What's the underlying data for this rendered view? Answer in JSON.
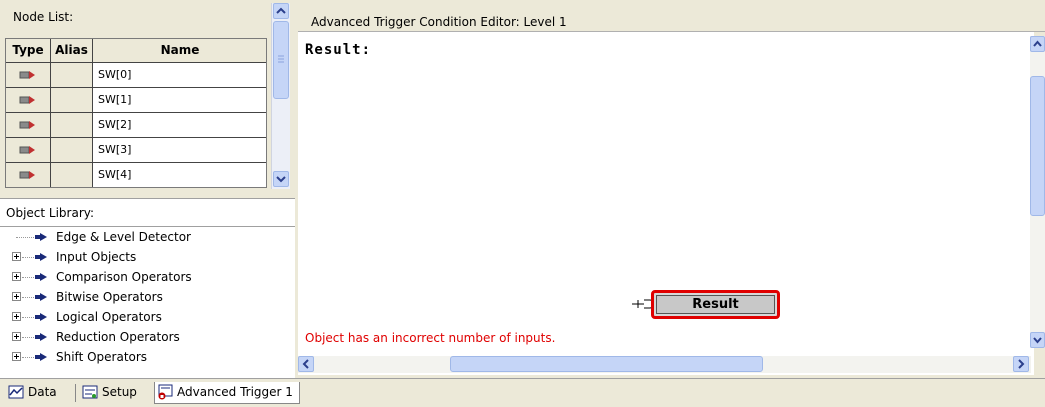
{
  "node_list": {
    "title": "Node List:",
    "columns": [
      "Type",
      "Alias",
      "Name"
    ],
    "rows": [
      {
        "name": "SW[0]"
      },
      {
        "name": "SW[1]"
      },
      {
        "name": "SW[2]"
      },
      {
        "name": "SW[3]"
      },
      {
        "name": "SW[4]"
      }
    ]
  },
  "object_library": {
    "title": "Object Library:",
    "items": [
      {
        "label": "Edge & Level Detector",
        "expandable": false
      },
      {
        "label": "Input Objects",
        "expandable": true
      },
      {
        "label": "Comparison Operators",
        "expandable": true
      },
      {
        "label": "Bitwise Operators",
        "expandable": true
      },
      {
        "label": "Logical Operators",
        "expandable": true
      },
      {
        "label": "Reduction Operators",
        "expandable": true
      },
      {
        "label": "Shift Operators",
        "expandable": true
      }
    ]
  },
  "editor": {
    "title": "Advanced Trigger Condition Editor: Level 1",
    "result_text": "Result:",
    "result_node_label": "Result",
    "error_message": "Object has an incorrect number of inputs.",
    "error_color": "#e00000"
  },
  "tabs": [
    {
      "label": "Data",
      "icon": "data-icon"
    },
    {
      "label": "Setup",
      "icon": "setup-icon"
    },
    {
      "label": "Advanced Trigger 1",
      "icon": "advanced-trigger-icon"
    }
  ],
  "colors": {
    "panel_bg": "#ece9d8",
    "scrollbar_blue": "#c5d5f7",
    "node_highlight": "#e00000"
  }
}
